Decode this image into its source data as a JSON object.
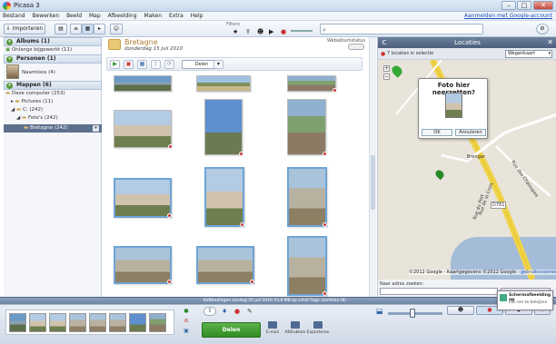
{
  "window": {
    "title": "Picasa 3",
    "min": "–",
    "max": "□",
    "close": "✕"
  },
  "menu": [
    "Bestand",
    "Bewerken",
    "Beeld",
    "Map",
    "Afbeelding",
    "Maken",
    "Extra",
    "Help"
  ],
  "signin": "Aanmelden met Google-account",
  "toolbar": {
    "import": "Importeren",
    "filter_label": "Filters",
    "search_placeholder": ""
  },
  "left": {
    "albums_header": "Albums (1)",
    "albums": [
      {
        "label": "Onlangs bijgewerkt (11)"
      }
    ],
    "people_header": "Personen (1)",
    "people": [
      {
        "label": "Naamloos (4)"
      }
    ],
    "folders_header": "Mappen (6)",
    "folders": [
      {
        "label": "Deze computer (253)"
      },
      {
        "label": "Pictures (11)"
      },
      {
        "label": "C: (242)"
      },
      {
        "label": "Foto's (242)"
      },
      {
        "label": "Bretagne (242)"
      }
    ]
  },
  "library": {
    "folder_title": "Bretagne",
    "folder_date": "donderdag 15 juli 2010",
    "web_album": "Webalbumstatus",
    "share": "Delen"
  },
  "map": {
    "header": "Locaties",
    "sub": "7 locaties in selectie",
    "type": "Wegenkaart",
    "popup_title": "Foto hier neerzetten?",
    "popup_ok": "OK",
    "popup_cancel": "Annuleren",
    "road1": "Rue du Port",
    "road2": "Rue de la Croix",
    "road3": "Rue des Chaloupes",
    "road4": "Brengar",
    "road5": "D781",
    "copyright": "©2012 Google - Kaartgegevens ©2012 Google - ",
    "terms": "gebruiksvoorwaarden",
    "addr_label": "Naar adres zoeken:"
  },
  "status": {
    "text": "Kaftbedingen   zondag 25 juli 2010   15,6 MB op schijf   Tags: portfolio (8)"
  },
  "tray": {
    "share": "Delen",
    "email": "E-mail",
    "print": "Afdrukken",
    "export": "Exporteren"
  },
  "notification": {
    "title": "Schermafbeelding op",
    "sub": "klik om te bekijken"
  }
}
